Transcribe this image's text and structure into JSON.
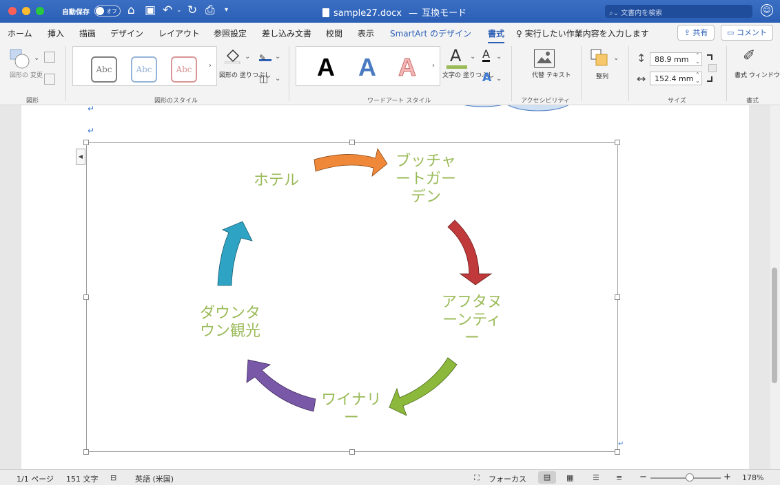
{
  "titlebar": {
    "autosave_label": "自動保存",
    "autosave_state": "オフ",
    "doc_title": "sample27.docx",
    "mode": "互換モード",
    "search_placeholder": "文書内を検索"
  },
  "tabs": {
    "items": [
      "ホーム",
      "挿入",
      "描画",
      "デザイン",
      "レイアウト",
      "参照設定",
      "差し込み文書",
      "校閲",
      "表示",
      "SmartArt のデザイン",
      "書式"
    ],
    "active": "書式",
    "tell_me": "実行したい作業内容を入力します",
    "share": "共有",
    "comment": "コメント"
  },
  "ribbon": {
    "shape_group": {
      "change_shape": "図形の\n変更",
      "label": "図形"
    },
    "shape_styles": {
      "samples": [
        "Abc",
        "Abc",
        "Abc"
      ],
      "sample_colors": [
        "#7f7f7f",
        "#95b3d7",
        "#d99694"
      ],
      "fill_label": "図形の\n塗りつぶし",
      "label": "図形のスタイル"
    },
    "wordart": {
      "samples": [
        "A",
        "A",
        "A"
      ],
      "text_fill": "文字の\n塗りつぶし",
      "label": "ワードアート スタイル"
    },
    "accessibility": {
      "alt_text": "代替\nテキスト",
      "label": "アクセシビリティ"
    },
    "arrange": {
      "label": "整列"
    },
    "size": {
      "height": "88.9 mm",
      "width": "152.4 mm",
      "label": "サイズ"
    },
    "format": {
      "pane": "書式\nウィンドウ",
      "label": "書式"
    }
  },
  "smartart": {
    "nodes": [
      "ブッチャ\nートガー\nデン",
      "アフタヌ\nーンティ\nー",
      "ワイナリ\nー",
      "ダウンタ\nウン観光",
      "ホテル"
    ],
    "text_color": "#9bbb59",
    "arrow_colors": [
      "#f0883a",
      "#c0393b",
      "#8cb83c",
      "#7a58a8",
      "#2fa3c4"
    ]
  },
  "statusbar": {
    "page": "1/1 ページ",
    "words": "151 文字",
    "language": "英語 (米国)",
    "focus": "フォーカス",
    "zoom": "178%",
    "zoom_percent": 178
  }
}
